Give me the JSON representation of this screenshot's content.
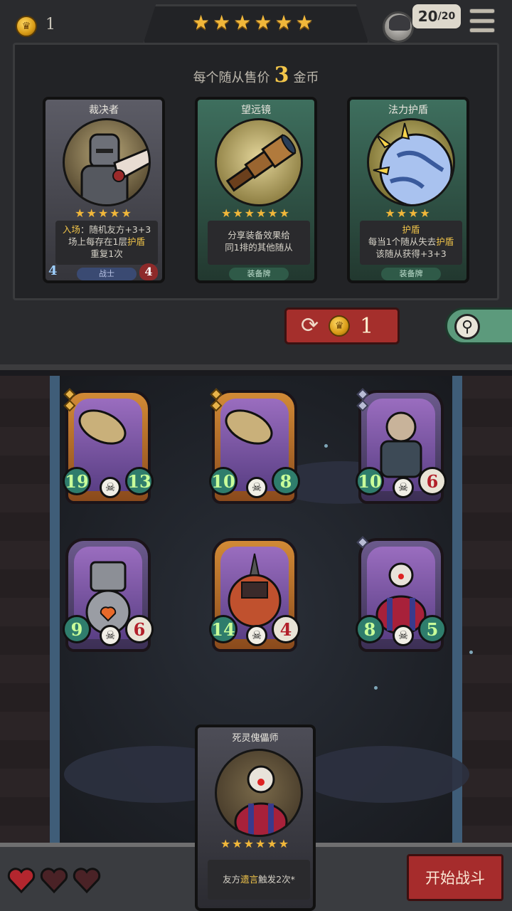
{
  "header": {
    "gold": "1",
    "tavern_stars": 6,
    "health_current": "20",
    "health_max": "/20",
    "coin_icon": "crown-coin-icon",
    "menu_icon": "hamburger-menu-icon"
  },
  "shop": {
    "price_prefix": "每个随从售价",
    "price_value": "3",
    "price_suffix": "金币",
    "cards": [
      {
        "title": "裁决者",
        "stars": "★★★★★",
        "text_parts": [
          "入场",
          "：随机友方+3+3",
          "场上每存在1层",
          "护盾",
          "重复1次"
        ],
        "tag": "战士",
        "attack": "4",
        "health": "4"
      },
      {
        "title": "望远镜",
        "stars": "★★★★★★",
        "text_line1": "分享装备效果给",
        "text_line2": "同1排的其他随从",
        "tag": "装备牌"
      },
      {
        "title": "法力护盾",
        "stars": "★★★★",
        "text_parts": [
          "护盾",
          "每当1个随从失去",
          "护盾",
          "该随从获得+3+3"
        ],
        "tag": "装备牌"
      }
    ],
    "refresh_cost": "1",
    "refresh_icon": "refresh-icon",
    "search_icon": "magnifier-icon"
  },
  "board": {
    "minions": [
      {
        "attack": "19",
        "health": "13",
        "frame": "gold",
        "stars_gems": 2
      },
      {
        "attack": "10",
        "health": "8",
        "frame": "gold",
        "stars_gems": 2
      },
      {
        "attack": "10",
        "health": "6",
        "frame": "purple",
        "stars_gems": 2
      },
      {
        "attack": "9",
        "health": "6",
        "frame": "purple",
        "stars_gems": 0
      },
      {
        "attack": "14",
        "health": "4",
        "frame": "gold",
        "stars_gems": 0
      },
      {
        "attack": "8",
        "health": "5",
        "frame": "purple",
        "stars_gems": 1
      }
    ],
    "selected_card": {
      "title": "死灵傀儡师",
      "stars": "★★★★★★",
      "text_a": "友方",
      "text_hl": "遗言",
      "text_b": "触发2次*"
    }
  },
  "footer": {
    "lives": 3,
    "start_label": "开始战斗"
  },
  "colors": {
    "gold_text": "#f3c64a",
    "button_red": "#a62c2c",
    "search_green": "#5c9a7c"
  }
}
